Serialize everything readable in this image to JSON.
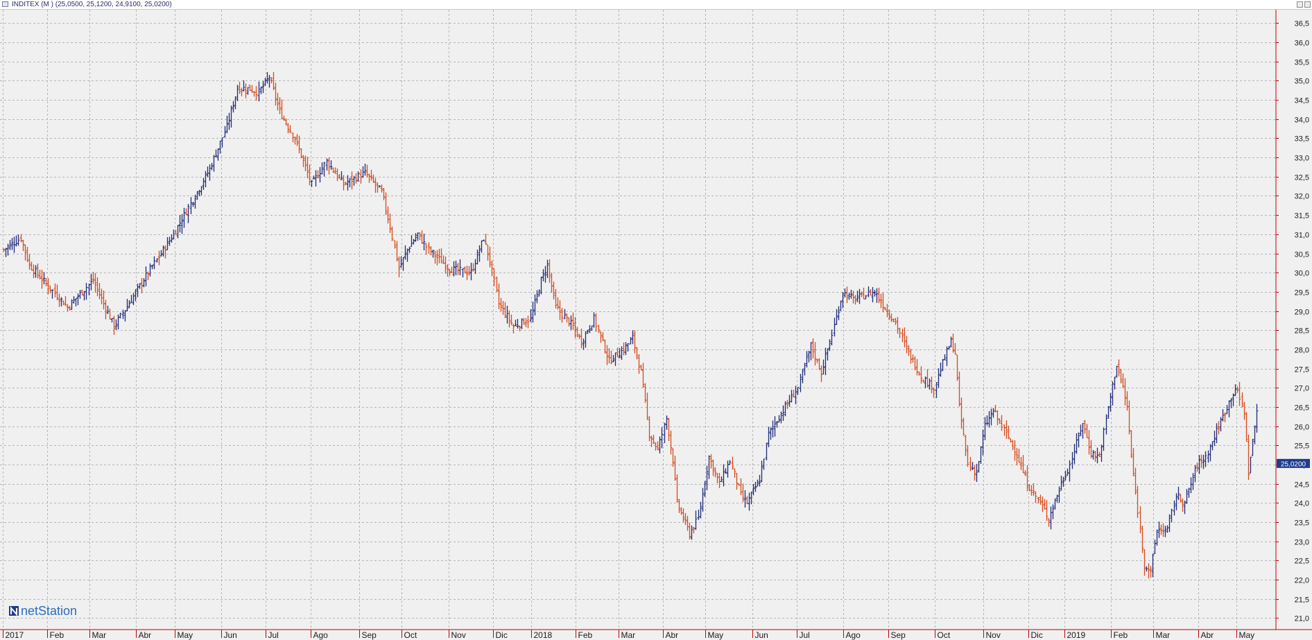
{
  "window": {
    "title": "INDITEX (M ) (25,0500, 25,1200, 24,9100, 25,0200)"
  },
  "chart_data": {
    "type": "ohlc",
    "title": "INDITEX (M ) (25,0500, 25,1200, 24,9100, 25,0200)",
    "symbol": "INDITEX",
    "last_price_label": "25,0200",
    "watermark": "netStation",
    "y_axis": {
      "side": "right",
      "ylim": [
        20.7,
        36.85
      ],
      "ticks": [
        21.0,
        21.5,
        22.0,
        22.5,
        23.0,
        23.5,
        24.0,
        24.5,
        25.0,
        25.5,
        26.0,
        26.5,
        27.0,
        27.5,
        28.0,
        28.5,
        29.0,
        29.5,
        30.0,
        30.5,
        31.0,
        31.5,
        32.0,
        32.5,
        33.0,
        33.5,
        34.0,
        34.5,
        35.0,
        35.5,
        36.0,
        36.5
      ],
      "tick_labels": [
        "21,0",
        "21,5",
        "22,0",
        "22,5",
        "23,0",
        "23,5",
        "24,0",
        "24,5",
        "25,0",
        "25,5",
        "26,0",
        "26,5",
        "27,0",
        "27,5",
        "28,0",
        "28,5",
        "29,0",
        "29,5",
        "30,0",
        "30,5",
        "31,0",
        "31,5",
        "32,0",
        "32,5",
        "33,0",
        "33,5",
        "34,0",
        "34,5",
        "35,0",
        "35,5",
        "36,0",
        "36,5"
      ]
    },
    "x_axis": {
      "tick_labels": [
        "2017",
        "Feb",
        "Mar",
        "Abr",
        "May",
        "Jun",
        "Jul",
        "Ago",
        "Sep",
        "Oct",
        "Nov",
        "Dic",
        "2018",
        "Feb",
        "Mar",
        "Abr",
        "May",
        "Jun",
        "Jul",
        "Ago",
        "Sep",
        "Oct",
        "Nov",
        "Dic",
        "2019",
        "Feb",
        "Mar",
        "Abr",
        "May"
      ]
    },
    "grid": true,
    "colors": {
      "up": "#1f2a7a",
      "down": "#d84a1b",
      "accent": "#c00000",
      "last_label_bg": "#1e3c8c"
    },
    "days_per_month": [
      21,
      20,
      22,
      18,
      22,
      21,
      21,
      23,
      20,
      22,
      21,
      18,
      21,
      20,
      21,
      20,
      22,
      21,
      22,
      21,
      22,
      23,
      21,
      17,
      22,
      20,
      21,
      18,
      10
    ],
    "close_keypoints": [
      [
        0,
        30.6
      ],
      [
        8,
        30.9
      ],
      [
        12,
        30.2
      ],
      [
        30,
        29.1
      ],
      [
        42,
        29.8
      ],
      [
        52,
        28.6
      ],
      [
        60,
        29.3
      ],
      [
        68,
        30.0
      ],
      [
        80,
        31.0
      ],
      [
        90,
        32.0
      ],
      [
        97,
        32.7
      ],
      [
        105,
        33.8
      ],
      [
        110,
        34.8
      ],
      [
        115,
        34.8
      ],
      [
        120,
        34.7
      ],
      [
        125,
        35.1
      ],
      [
        130,
        34.2
      ],
      [
        137,
        33.5
      ],
      [
        145,
        32.3
      ],
      [
        152,
        32.9
      ],
      [
        160,
        32.3
      ],
      [
        170,
        32.6
      ],
      [
        178,
        32.1
      ],
      [
        182,
        31.2
      ],
      [
        186,
        30.1
      ],
      [
        190,
        30.6
      ],
      [
        195,
        31.0
      ],
      [
        200,
        30.6
      ],
      [
        210,
        30.1
      ],
      [
        220,
        30.0
      ],
      [
        226,
        30.9
      ],
      [
        229,
        30.3
      ],
      [
        233,
        29.2
      ],
      [
        240,
        28.6
      ],
      [
        248,
        28.8
      ],
      [
        253,
        29.8
      ],
      [
        256,
        30.2
      ],
      [
        260,
        29.1
      ],
      [
        268,
        28.6
      ],
      [
        272,
        28.2
      ],
      [
        278,
        28.8
      ],
      [
        285,
        27.7
      ],
      [
        292,
        28.0
      ],
      [
        296,
        28.3
      ],
      [
        300,
        27.4
      ],
      [
        304,
        25.8
      ],
      [
        308,
        25.4
      ],
      [
        312,
        26.2
      ],
      [
        315,
        25.1
      ],
      [
        317,
        24.0
      ],
      [
        323,
        23.2
      ],
      [
        327,
        23.6
      ],
      [
        332,
        25.2
      ],
      [
        337,
        24.5
      ],
      [
        342,
        25.1
      ],
      [
        347,
        24.2
      ],
      [
        350,
        24.0
      ],
      [
        356,
        24.6
      ],
      [
        360,
        25.8
      ],
      [
        368,
        26.5
      ],
      [
        374,
        27.0
      ],
      [
        380,
        28.1
      ],
      [
        385,
        27.4
      ],
      [
        390,
        28.4
      ],
      [
        395,
        29.5
      ],
      [
        400,
        29.3
      ],
      [
        405,
        29.4
      ],
      [
        410,
        29.5
      ],
      [
        416,
        29.0
      ],
      [
        420,
        28.7
      ],
      [
        426,
        27.9
      ],
      [
        432,
        27.3
      ],
      [
        438,
        27.0
      ],
      [
        443,
        27.8
      ],
      [
        446,
        28.2
      ],
      [
        448,
        27.9
      ],
      [
        450,
        26.5
      ],
      [
        454,
        25.0
      ],
      [
        458,
        24.8
      ],
      [
        462,
        26.0
      ],
      [
        466,
        26.4
      ],
      [
        470,
        26.0
      ],
      [
        476,
        25.4
      ],
      [
        482,
        24.5
      ],
      [
        488,
        24.0
      ],
      [
        492,
        23.6
      ],
      [
        498,
        24.5
      ],
      [
        502,
        25.0
      ],
      [
        508,
        26.1
      ],
      [
        512,
        25.3
      ],
      [
        516,
        25.2
      ],
      [
        520,
        26.5
      ],
      [
        524,
        27.6
      ],
      [
        527,
        27.0
      ],
      [
        529,
        26.5
      ],
      [
        531,
        25.2
      ],
      [
        534,
        23.8
      ],
      [
        537,
        22.4
      ],
      [
        540,
        22.2
      ],
      [
        543,
        23.3
      ],
      [
        548,
        23.3
      ],
      [
        552,
        24.2
      ],
      [
        556,
        24.0
      ],
      [
        562,
        25.0
      ],
      [
        566,
        25.2
      ],
      [
        572,
        26.0
      ],
      [
        576,
        26.5
      ],
      [
        580,
        27.0
      ],
      [
        584,
        26.4
      ],
      [
        586,
        24.8
      ],
      [
        590,
        26.4
      ],
      [
        596,
        26.3
      ],
      [
        600,
        26.7
      ],
      [
        604,
        26.6
      ],
      [
        608,
        27.1
      ],
      [
        611,
        27.5
      ],
      [
        614,
        26.6
      ],
      [
        617,
        25.7
      ],
      [
        620,
        25.1
      ],
      [
        622,
        25.0
      ]
    ]
  }
}
